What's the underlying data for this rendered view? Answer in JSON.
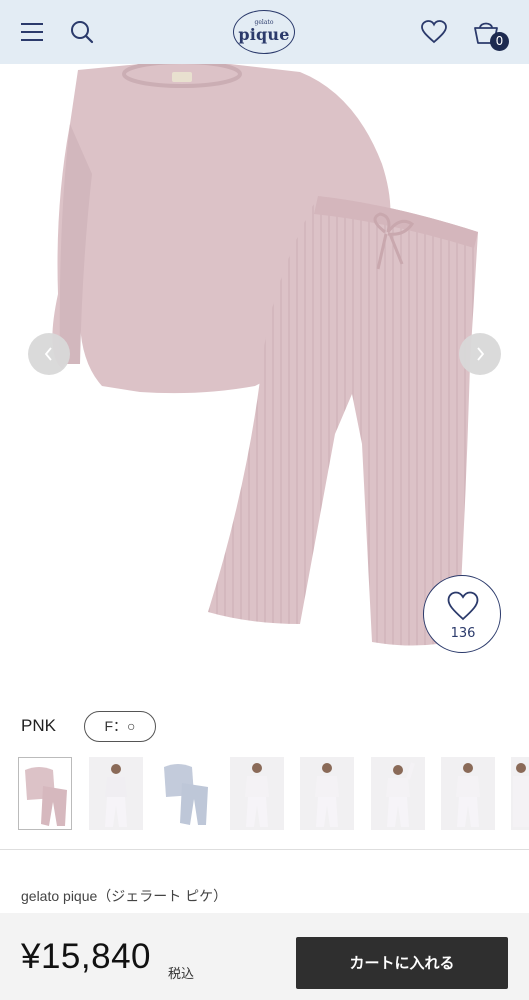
{
  "header": {
    "logo_small": "gelato",
    "logo_main": "pique",
    "cart_count": "0"
  },
  "product": {
    "favorite_count": "136",
    "color": "PNK",
    "size": "F：○",
    "brand": "gelato pique（ジェラート ピケ）",
    "price": "¥15,840",
    "tax_label": "税込",
    "cart_button": "カートに入れる"
  },
  "colors": {
    "header_bg": "#e3ecf4",
    "brand_navy": "#2b3a6b",
    "product_pink": "#dcc2c7",
    "cart_button_bg": "#2f2f2f"
  },
  "icons": [
    "menu-icon",
    "search-icon",
    "heart-icon",
    "cart-icon",
    "chevron-left-icon",
    "chevron-right-icon"
  ]
}
